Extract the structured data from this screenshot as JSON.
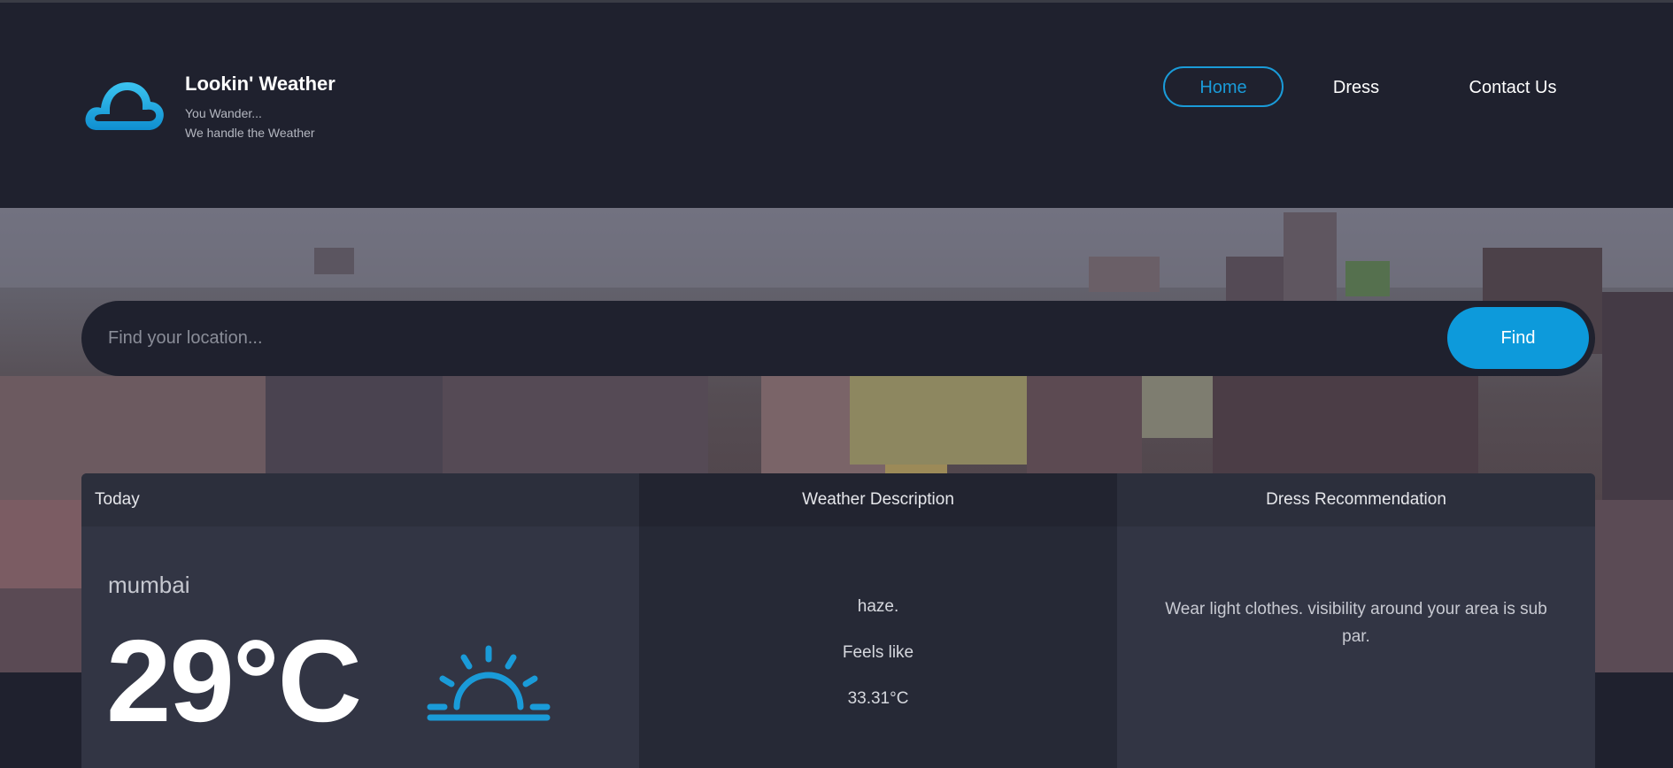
{
  "header": {
    "brand_title": "Lookin' Weather",
    "tagline_line1": "You Wander...",
    "tagline_line2": "We handle the Weather",
    "logo_icon": "cloud-icon",
    "accent_color": "#1a9bd8"
  },
  "nav": {
    "items": [
      {
        "label": "Home",
        "active": true
      },
      {
        "label": "Dress",
        "active": false
      },
      {
        "label": "Contact Us",
        "active": false
      }
    ]
  },
  "search": {
    "placeholder": "Find your location...",
    "value": "",
    "button_label": "Find",
    "button_color": "#0d9adb"
  },
  "forecast": {
    "today": {
      "header": "Today",
      "city": "mumbai",
      "temperature": "29°C",
      "icon": "sunrise-icon"
    },
    "description": {
      "header": "Weather Description",
      "condition": "haze.",
      "feels_like_label": "Feels like",
      "feels_like_value": "33.31°C"
    },
    "dress": {
      "header": "Dress Recommendation",
      "recommendation": "Wear light clothes. visibility around your area is sub par."
    }
  }
}
